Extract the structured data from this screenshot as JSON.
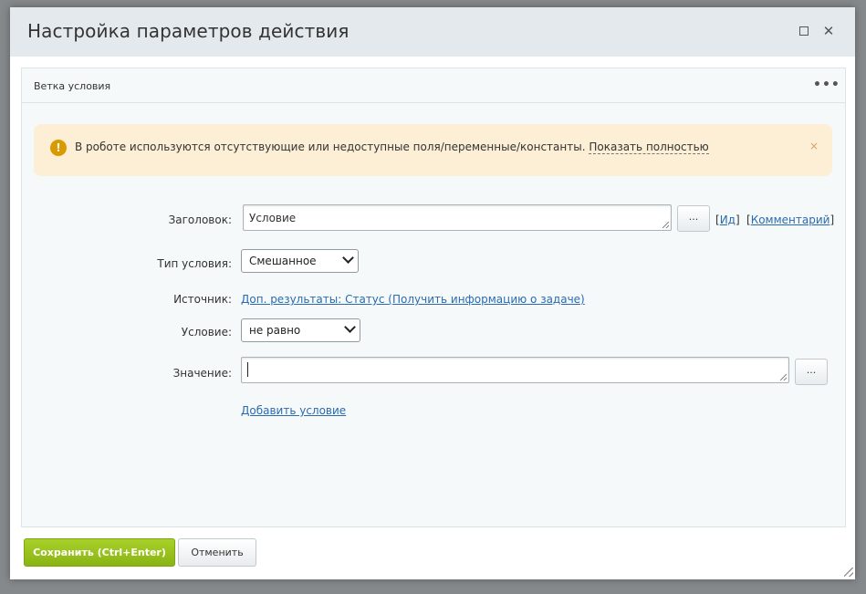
{
  "dialog": {
    "title": "Настройка параметров действия",
    "maximize_icon": "maximize-icon",
    "close_icon": "close-icon"
  },
  "panel": {
    "title": "Ветка условия",
    "more_icon": "more-icon",
    "more_glyph": "•••"
  },
  "alert": {
    "icon": "warning-icon",
    "icon_glyph": "!",
    "text": "В роботе используются отсутствующие или недоступные поля/переменные/константы.",
    "link": "Показать полностью",
    "close_glyph": "×",
    "color": "#fdefd5"
  },
  "form": {
    "title_label": "Заголовок:",
    "title_value": "Условие",
    "dots": "...",
    "id_link": "Ид",
    "comment_link": "Комментарий",
    "condition_type_label": "Тип условия:",
    "condition_type_value": "Смешанное",
    "source_label": "Источник:",
    "source_link": "Доп. результаты: Статус (Получить информацию о задаче)",
    "condition_label": "Условие:",
    "condition_value": "не равно",
    "value_label": "Значение:",
    "value_value": "",
    "add_condition_link": "Добавить условие"
  },
  "footer": {
    "save_label": "Сохранить (Ctrl+Enter)",
    "cancel_label": "Отменить",
    "save_color": "#9bc41f"
  }
}
